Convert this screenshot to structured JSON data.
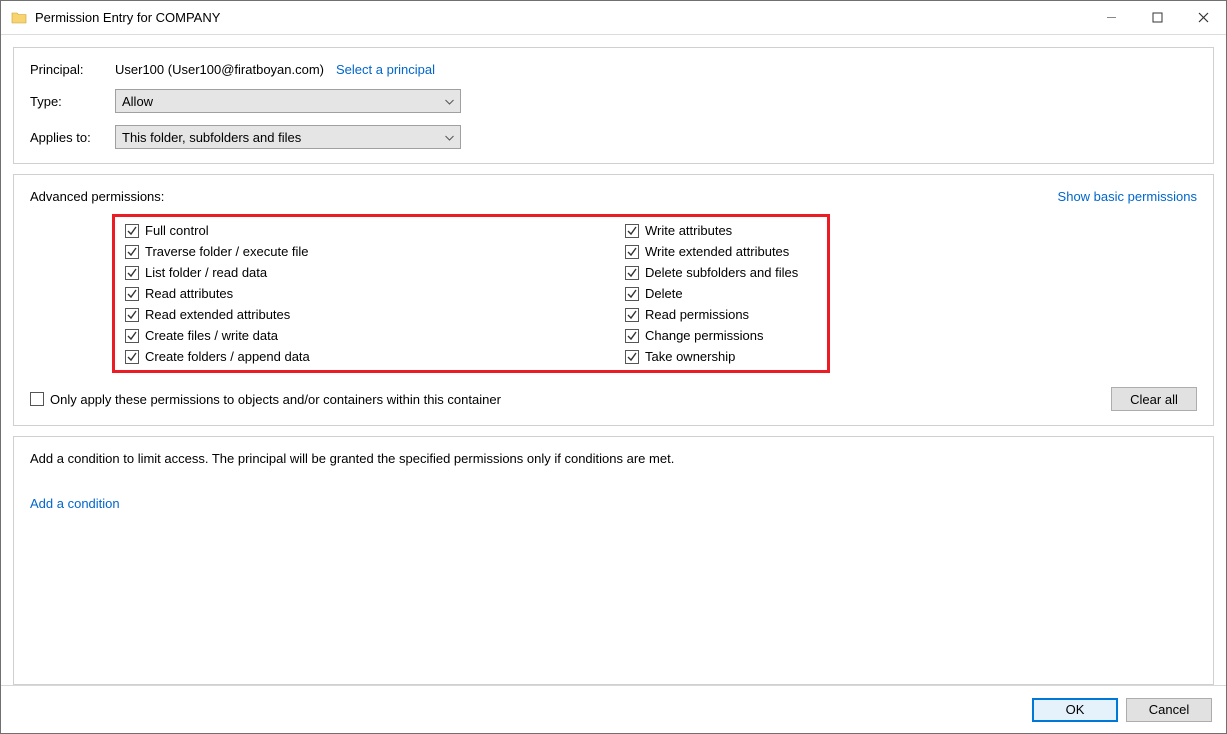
{
  "window": {
    "title": "Permission Entry for COMPANY"
  },
  "top": {
    "principal_label": "Principal:",
    "principal_value": "User100 (User100@firatboyan.com)",
    "select_principal": "Select a principal",
    "type_label": "Type:",
    "type_value": "Allow",
    "applies_label": "Applies to:",
    "applies_value": "This folder, subfolders and files"
  },
  "adv": {
    "header": "Advanced permissions:",
    "show_basic": "Show basic permissions",
    "left": [
      "Full control",
      "Traverse folder / execute file",
      "List folder / read data",
      "Read attributes",
      "Read extended attributes",
      "Create files / write data",
      "Create folders / append data"
    ],
    "right": [
      "Write attributes",
      "Write extended attributes",
      "Delete subfolders and files",
      "Delete",
      "Read permissions",
      "Change permissions",
      "Take ownership"
    ],
    "only_apply": "Only apply these permissions to objects and/or containers within this container",
    "clear_all": "Clear all"
  },
  "cond": {
    "text": "Add a condition to limit access. The principal will be granted the specified permissions only if conditions are met.",
    "add_link": "Add a condition"
  },
  "footer": {
    "ok": "OK",
    "cancel": "Cancel"
  }
}
